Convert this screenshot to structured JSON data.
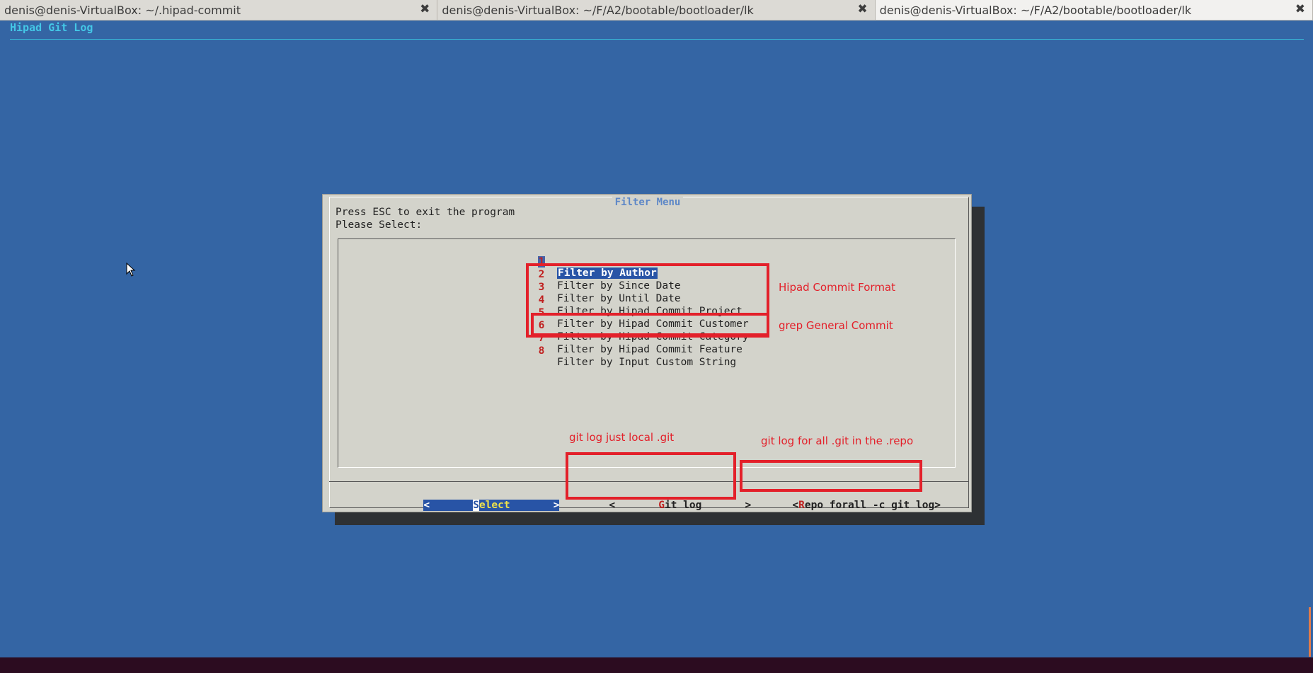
{
  "tabs": [
    {
      "title": "denis@denis-VirtualBox: ~/.hipad-commit",
      "close_icon": "close-icon"
    },
    {
      "title": "denis@denis-VirtualBox: ~/F/A2/bootable/bootloader/lk",
      "close_icon": "close-icon"
    },
    {
      "title": "denis@denis-VirtualBox: ~/F/A2/bootable/bootloader/lk",
      "close_icon": "close-icon"
    }
  ],
  "terminal": {
    "backtitle": "Hipad Git Log"
  },
  "dialog": {
    "title": "Filter Menu",
    "line1": "Press ESC to exit the program",
    "line2": "Please Select:",
    "items": [
      {
        "key": "1",
        "label": "Filter by Author",
        "selected": true
      },
      {
        "key": "2",
        "label": "Filter by Since Date"
      },
      {
        "key": "3",
        "label": "Filter by Until Date"
      },
      {
        "key": "4",
        "label": "Filter by Hipad Commit Project"
      },
      {
        "key": "5",
        "label": "Filter by Hipad Commit Customer"
      },
      {
        "key": "6",
        "label": "Filter by Hipad Commit Category"
      },
      {
        "key": "7",
        "label": "Filter by Hipad Commit Feature"
      },
      {
        "key": "8",
        "label": "Filter by Input Custom String"
      }
    ],
    "buttons": {
      "select": {
        "left": "<",
        "pad": "       ",
        "hot": "S",
        "rest": "elect",
        "pad2": "       ",
        "right": ">"
      },
      "gitlog": {
        "left": "<",
        "pad": "       ",
        "hot": "G",
        "rest": "it log",
        "pad2": "       ",
        "right": ">"
      },
      "repo": {
        "left": "<",
        "hot": "R",
        "rest": "epo forall -c git log",
        "right": ">"
      }
    }
  },
  "annotations": {
    "hipad_format": "Hipad Commit Format",
    "grep_general": "grep General Commit",
    "local_git": "git log just local .git",
    "all_git": "git log  for all .git in the .repo"
  },
  "colors": {
    "terminal_bg": "#3465a4",
    "dialog_bg": "#d3d3cb",
    "annotation_red": "#e3202a",
    "selection_blue": "#2854a6"
  }
}
